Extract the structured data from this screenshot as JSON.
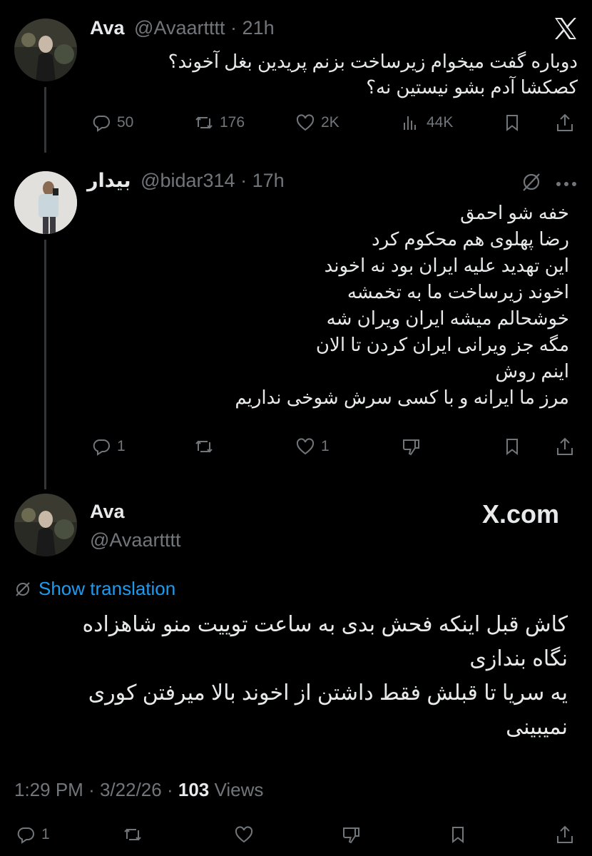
{
  "tweet1": {
    "name": "Ava",
    "handle": "@Avaartttt",
    "sep": "·",
    "time": "21h",
    "text_lines": [
      "دوباره گفت میخوام زیرساخت بزنم پریدین بغل آخوند؟",
      "کصکشا آدم بشو نیستین نه؟"
    ],
    "actions": {
      "replies": "50",
      "reposts": "176",
      "likes": "2K",
      "views": "44K"
    },
    "logo_icon": "x-logo-icon"
  },
  "tweet2": {
    "name": "بیدار",
    "handle": "@bidar314",
    "sep": "·",
    "time": "17h",
    "text_lines": [
      "خفه شو احمق",
      "رضا پهلوی هم محکوم کرد",
      "این تهدید علیه ایران بود نه اخوند",
      "اخوند زیرساخت ما به تخمشه",
      "خوشحالم میشه ایران ویران شه",
      "مگه جز ویرانی ایران کردن تا الان",
      "اینم روش",
      "مرز ما ایرانه و با کسی سرش شوخی نداریم"
    ],
    "actions": {
      "replies": "1",
      "likes": "1"
    }
  },
  "tweet3": {
    "name": "Ava",
    "handle": "@Avaartttt",
    "brand": "X.com",
    "translate": "Show translation",
    "text_lines": [
      "کاش قبل اینکه فحش بدی به ساعت توییت منو شاهزاده",
      "نگاه بندازی",
      "یه سریا تا قبلش فقط داشتن از اخوند بالا میرفتن کوری",
      "نمیبینی"
    ],
    "meta_time": "1:29 PM",
    "meta_sep1": "·",
    "meta_date": "3/22/26",
    "meta_sep2": "·",
    "meta_views_count": "103",
    "meta_views_label": "Views",
    "actions": {
      "replies": "1"
    }
  },
  "colors": {
    "background": "#000000",
    "text": "#e7e9ea",
    "muted": "#71767b",
    "link": "#1d9bf0",
    "thread_line": "#333639"
  }
}
